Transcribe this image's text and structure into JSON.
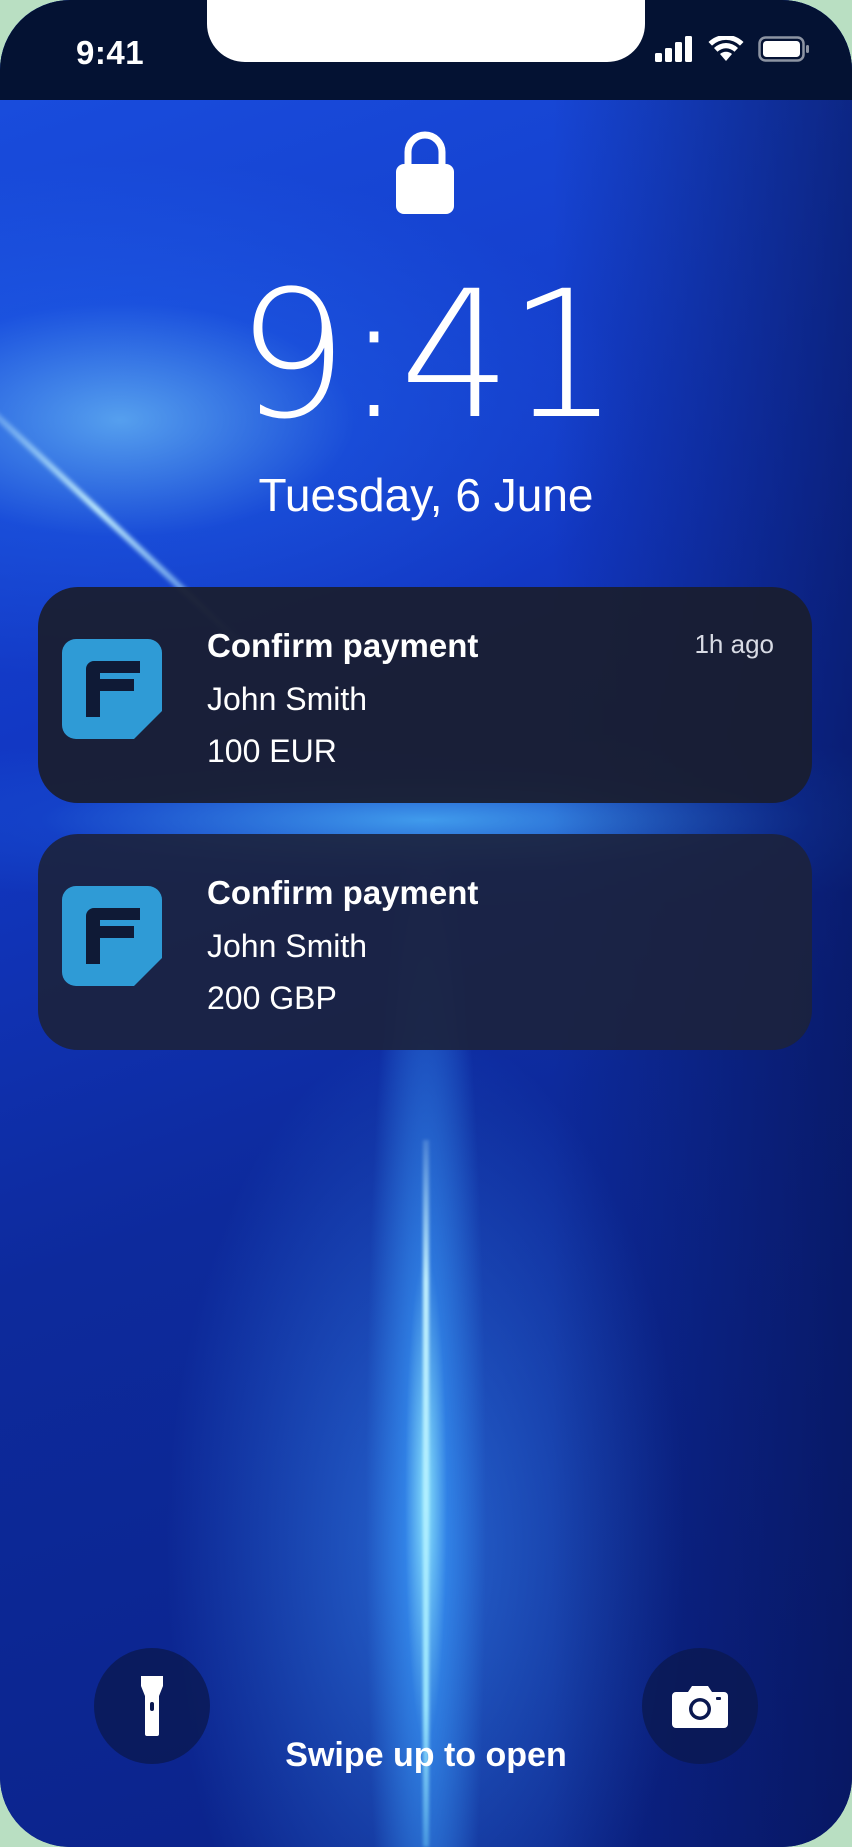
{
  "status_bar": {
    "time": "9:41",
    "icons": [
      "cellular-signal-icon",
      "wifi-icon",
      "battery-icon"
    ]
  },
  "lock_screen": {
    "lock_icon": "lock-icon",
    "clock": "9:41",
    "date": "Tuesday, 6 June",
    "swipe_hint": "Swipe up to open"
  },
  "notifications": [
    {
      "app_icon": "payment-app-icon",
      "title": "Confirm payment",
      "line1": "John Smith",
      "line2": "100 EUR",
      "time": "1h ago"
    },
    {
      "app_icon": "payment-app-icon",
      "title": "Confirm payment",
      "line1": "John Smith",
      "line2": "200 GBP",
      "time": ""
    }
  ],
  "quick_actions": {
    "left": "flashlight-icon",
    "right": "camera-icon"
  },
  "colors": {
    "app_icon_bg": "#2f9bd6",
    "app_icon_glyph": "#0f1a36",
    "notification_bg": "#1a1e30",
    "status_bar_bg": "#041233",
    "frame_bg": "#b9dfc2"
  }
}
